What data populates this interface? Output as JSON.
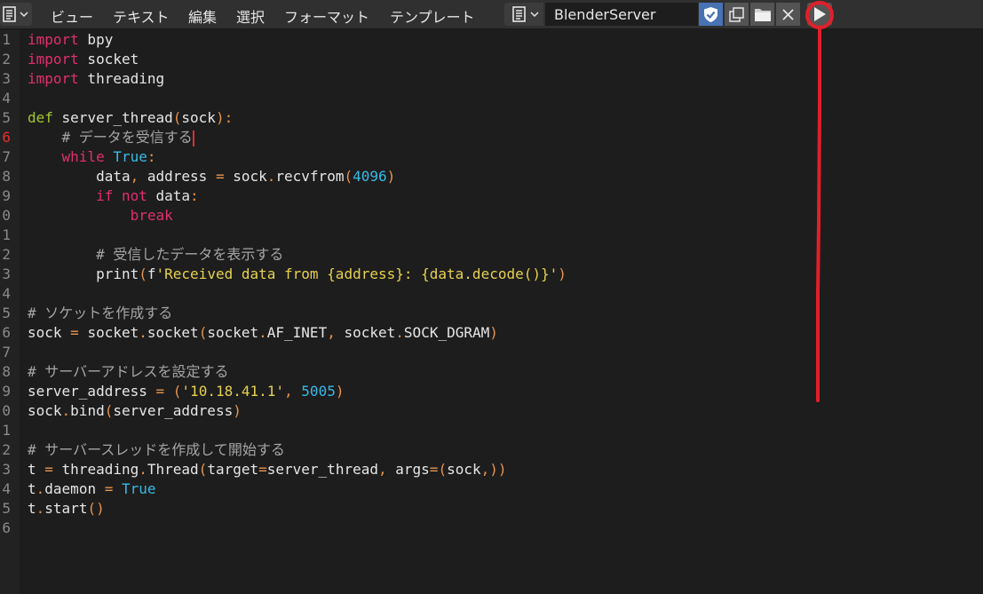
{
  "menu": {
    "view": "ビュー",
    "text": "テキスト",
    "edit": "編集",
    "select": "選択",
    "format": "フォーマット",
    "templates": "テンプレート"
  },
  "textblock": {
    "name": "BlenderServer"
  },
  "icons": {
    "editor_type": "text-editor-icon",
    "chevron": "chevron-down-icon",
    "fake_user": "shield-check-icon",
    "duplicate": "duplicate-icon",
    "open": "folder-icon",
    "unlink": "close-icon",
    "run": "play-icon"
  },
  "colors": {
    "keyword": "#e12f6e",
    "def_keyword": "#a3c631",
    "operator": "#e8944e",
    "number": "#38b9e6",
    "string": "#e6d150",
    "comment": "#a5a5a5",
    "annotation": "#e0202a"
  },
  "editor": {
    "current_line": 6,
    "line_numbers": [
      "1",
      "2",
      "3",
      "4",
      "5",
      "6",
      "7",
      "8",
      "9",
      "0",
      "1",
      "2",
      "3",
      "4",
      "5",
      "6",
      "7",
      "8",
      "9",
      "0",
      "1",
      "2",
      "3",
      "4",
      "5",
      "6"
    ],
    "tokens": {
      "l1_kw": "import",
      "l1_rest": " bpy",
      "l2_kw": "import",
      "l2_rest": " socket",
      "l3_kw": "import",
      "l3_rest": " threading",
      "l5_def": "def",
      "l5_a": " server_thread",
      "l5_p1": "(",
      "l5_b": "sock",
      "l5_p2": "):",
      "l6_comment": "    # データを受信する",
      "l7_indent": "    ",
      "l7_kw": "while",
      "l7_sp": " ",
      "l7_bool": "True",
      "l7_op": ":",
      "l8_a": "        data",
      "l8_c": ",",
      "l8_b": " address ",
      "l8_eq": "=",
      "l8_c2": " sock",
      "l8_dot": ".",
      "l8_d": "recvfrom",
      "l8_p1": "(",
      "l8_num": "4096",
      "l8_p2": ")",
      "l9_indent": "        ",
      "l9_kw": "if not",
      "l9_rest": " data",
      "l9_op": ":",
      "l10_indent": "            ",
      "l10_kw": "break",
      "l12_comment": "        # 受信したデータを表示する",
      "l13_a": "        print",
      "l13_p1": "(",
      "l13_b": "f",
      "l13_str": "'Received data from {address}: {data.decode()}'",
      "l13_p2": ")",
      "l15_comment": "# ソケットを作成する",
      "l16_a": "sock ",
      "l16_eq": "=",
      "l16_b": " socket",
      "l16_dot": ".",
      "l16_c": "socket",
      "l16_p1": "(",
      "l16_d": "socket",
      "l16_dot2": ".",
      "l16_e": "AF_INET",
      "l16_cm": ",",
      "l16_f": " socket",
      "l16_dot3": ".",
      "l16_g": "SOCK_DGRAM",
      "l16_p2": ")",
      "l18_comment": "# サーバーアドレスを設定する",
      "l19_a": "server_address ",
      "l19_eq": "=",
      "l19_sp": " ",
      "l19_p1": "(",
      "l19_str": "'10.18.41.1'",
      "l19_cm": ",",
      "l19_sp2": " ",
      "l19_num": "5005",
      "l19_p2": ")",
      "l20_a": "sock",
      "l20_dot": ".",
      "l20_b": "bind",
      "l20_p1": "(",
      "l20_c": "server_address",
      "l20_p2": ")",
      "l22_comment": "# サーバースレッドを作成して開始する",
      "l23_a": "t ",
      "l23_eq": "=",
      "l23_b": " threading",
      "l23_dot": ".",
      "l23_c": "Thread",
      "l23_p1": "(",
      "l23_d": "target",
      "l23_eq2": "=",
      "l23_e": "server_thread",
      "l23_cm": ",",
      "l23_f": " args",
      "l23_eq3": "=",
      "l23_p2": "(",
      "l23_g": "sock",
      "l23_cm2": ",",
      "l23_p3": "))",
      "l24_a": "t",
      "l24_dot": ".",
      "l24_b": "daemon ",
      "l24_eq": "=",
      "l24_sp": " ",
      "l24_bool": "True",
      "l25_a": "t",
      "l25_dot": ".",
      "l25_b": "start",
      "l25_p": "()"
    }
  }
}
